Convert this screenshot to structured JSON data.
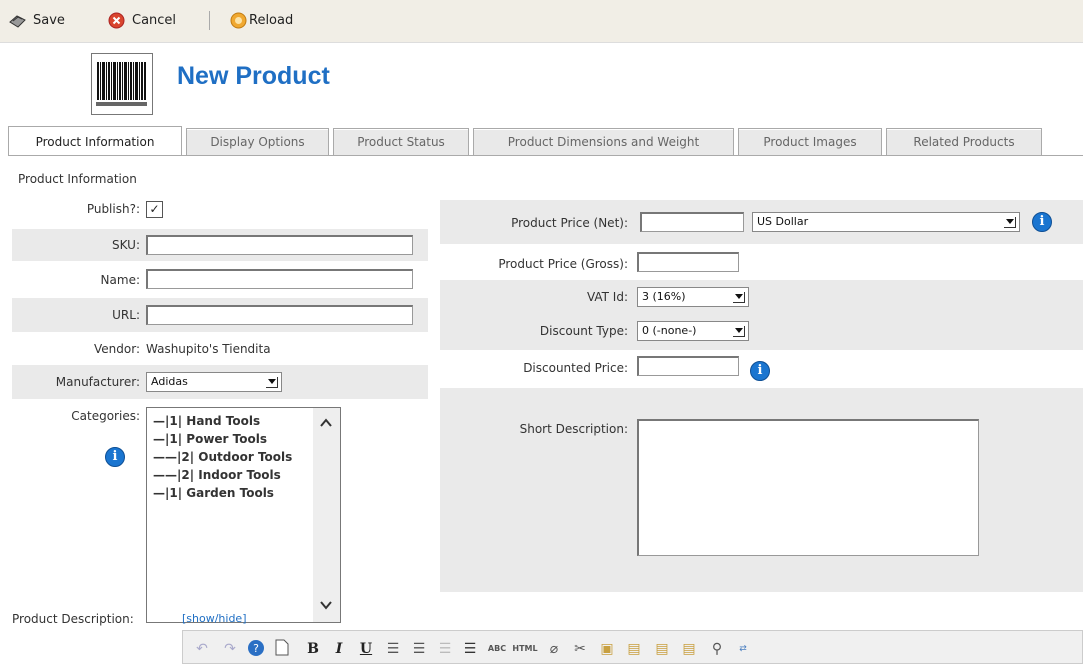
{
  "toolbar": {
    "save_label": "Save",
    "cancel_label": "Cancel",
    "reload_label": "Reload"
  },
  "page": {
    "title": "New Product"
  },
  "tabs": [
    {
      "label": "Product Information"
    },
    {
      "label": "Display Options"
    },
    {
      "label": "Product Status"
    },
    {
      "label": "Product Dimensions and Weight"
    },
    {
      "label": "Product Images"
    },
    {
      "label": "Related Products"
    }
  ],
  "section_title": "Product Information",
  "left_form": {
    "publish_label": "Publish?:",
    "publish_checked": "✓",
    "sku_label": "SKU:",
    "name_label": "Name:",
    "url_label": "URL:",
    "vendor_label": "Vendor:",
    "vendor_value": "Washupito's Tiendita",
    "manufacturer_label": "Manufacturer:",
    "manufacturer_value": "Adidas",
    "categories_label": "Categories:",
    "categories": [
      "—|1| Hand Tools",
      "—|1| Power Tools",
      "——|2| Outdoor Tools",
      "——|2| Indoor Tools",
      "—|1| Garden Tools"
    ]
  },
  "right_form": {
    "price_net_label": "Product Price (Net):",
    "currency_value": "US Dollar",
    "price_gross_label": "Product Price (Gross):",
    "vat_label": "VAT Id:",
    "vat_value": "3 (16%)",
    "discount_type_label": "Discount Type:",
    "discount_type_value": "0 (-none-)",
    "discounted_price_label": "Discounted Price:",
    "short_desc_label": "Short Description:"
  },
  "description": {
    "label": "Product Description:",
    "toggle_label": "[show/hide]"
  },
  "editor": {
    "bold": "B",
    "italic": "I",
    "underline": "U",
    "abc": "ABC",
    "html": "HTML"
  },
  "colors": {
    "title_blue": "#1f6fc4",
    "info_blue": "#1a75d0",
    "cancel_red": "#d9452e",
    "reload_orange": "#f0a830"
  }
}
